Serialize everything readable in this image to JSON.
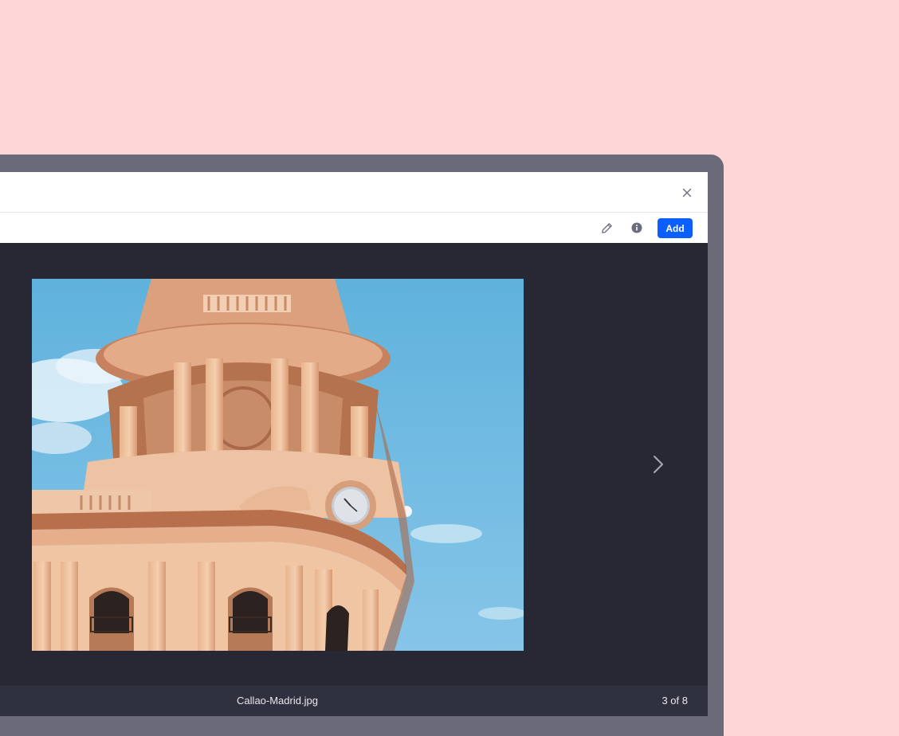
{
  "toolbar": {
    "add_label": "Add",
    "edit_icon": "pencil-icon",
    "info_icon": "info-circle-icon"
  },
  "titlebar": {
    "close_icon": "close-icon"
  },
  "viewer": {
    "image_description_icon": "building-photo",
    "next_icon": "chevron-right-icon"
  },
  "footer": {
    "filename": "Callao-Madrid.jpg",
    "counter": "3 of 8"
  },
  "colors": {
    "background": "#ffd6d7",
    "device_frame": "#6b6a78",
    "viewer_bg": "#272833",
    "footer_bg": "#30313f",
    "accent": "#0b5fff"
  }
}
